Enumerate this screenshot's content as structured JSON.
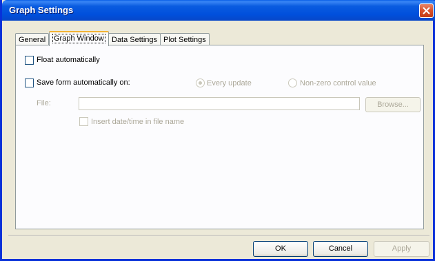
{
  "window": {
    "title": "Graph Settings"
  },
  "tabs": [
    {
      "label": "General"
    },
    {
      "label": "Graph Window"
    },
    {
      "label": "Data Settings"
    },
    {
      "label": "Plot Settings"
    }
  ],
  "graph_window": {
    "float_label": "Float automatically",
    "save_form_label": "Save form automatically on:",
    "radio_every_update": "Every update",
    "radio_nonzero": "Non-zero control value",
    "file_label": "File:",
    "file_value": "",
    "browse_label": "Browse...",
    "insert_datetime_label": "Insert date/time in file name"
  },
  "footer": {
    "ok_label": "OK",
    "cancel_label": "Cancel",
    "apply_label": "Apply"
  }
}
